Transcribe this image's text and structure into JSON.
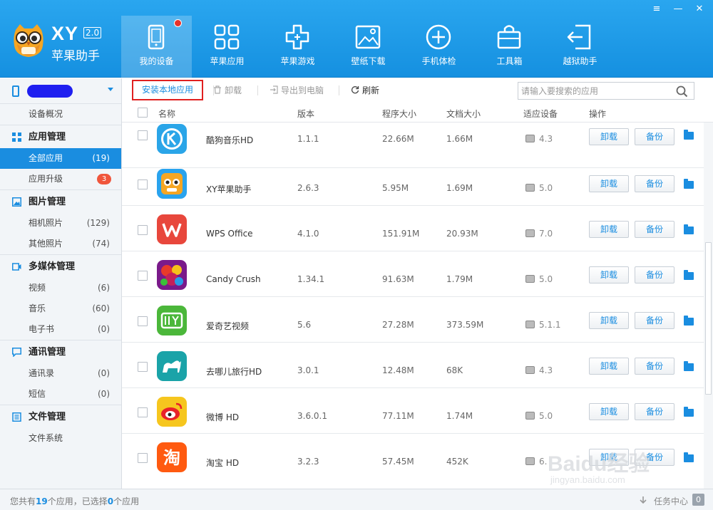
{
  "brand": {
    "logo_text": "XY",
    "version": "2.0",
    "name": "苹果助手"
  },
  "window_controls": {
    "menu": "≡",
    "minimize": "—",
    "close": "✕"
  },
  "nav": [
    {
      "label": "我的设备",
      "icon": "device-icon",
      "active": true,
      "has_dot": true
    },
    {
      "label": "苹果应用",
      "icon": "apps-icon"
    },
    {
      "label": "苹果游戏",
      "icon": "gamepad-icon"
    },
    {
      "label": "壁纸下载",
      "icon": "wallpaper-icon"
    },
    {
      "label": "手机体检",
      "icon": "checkup-icon"
    },
    {
      "label": "工具箱",
      "icon": "toolbox-icon"
    },
    {
      "label": "越狱助手",
      "icon": "jailbreak-icon"
    }
  ],
  "sidebar": {
    "overview": "设备概况",
    "groups": [
      {
        "title": "应用管理",
        "icon": "grid-icon",
        "items": [
          {
            "label": "全部应用",
            "count": "(19)",
            "active": true
          },
          {
            "label": "应用升级",
            "badge": "3"
          }
        ]
      },
      {
        "title": "图片管理",
        "icon": "image-icon",
        "items": [
          {
            "label": "相机照片",
            "count": "(129)"
          },
          {
            "label": "其他照片",
            "count": "(74)"
          }
        ]
      },
      {
        "title": "多媒体管理",
        "icon": "media-icon",
        "items": [
          {
            "label": "视频",
            "count": "(6)"
          },
          {
            "label": "音乐",
            "count": "(60)"
          },
          {
            "label": "电子书",
            "count": "(0)"
          }
        ]
      },
      {
        "title": "通讯管理",
        "icon": "chat-icon",
        "items": [
          {
            "label": "通讯录",
            "count": "(0)"
          },
          {
            "label": "短信",
            "count": "(0)"
          }
        ]
      },
      {
        "title": "文件管理",
        "icon": "file-icon",
        "items": [
          {
            "label": "文件系统"
          }
        ]
      }
    ]
  },
  "toolbar": {
    "install": "安装本地应用",
    "uninstall": "卸载",
    "export": "导出到电脑",
    "refresh": "刷新",
    "search_placeholder": "请输入要搜索的应用"
  },
  "table": {
    "headers": {
      "name": "名称",
      "version": "版本",
      "program_size": "程序大小",
      "doc_size": "文档大小",
      "device": "适应设备",
      "action": "操作"
    },
    "uninstall_label": "卸载",
    "backup_label": "备份",
    "rows": [
      {
        "name": "酷狗音乐HD",
        "version": "1.1.1",
        "program_size": "22.66M",
        "doc_size": "1.66M",
        "device": "4.3",
        "icon": "kugou-icon",
        "color": "#2aa5e8"
      },
      {
        "name": "XY苹果助手",
        "version": "2.6.3",
        "program_size": "5.95M",
        "doc_size": "1.69M",
        "device": "5.0",
        "icon": "xy-owl-icon",
        "color": "#1a8de0"
      },
      {
        "name": "WPS Office",
        "version": "4.1.0",
        "program_size": "151.91M",
        "doc_size": "20.93M",
        "device": "7.0",
        "icon": "wps-icon",
        "color": "#e8473c"
      },
      {
        "name": "Candy Crush",
        "version": "1.34.1",
        "program_size": "91.63M",
        "doc_size": "1.79M",
        "device": "5.0",
        "icon": "candy-crush-icon",
        "color": "#c4205a"
      },
      {
        "name": "爱奇艺视频",
        "version": "5.6",
        "program_size": "27.28M",
        "doc_size": "373.59M",
        "device": "5.1.1",
        "icon": "iqiyi-icon",
        "color": "#4bb73a"
      },
      {
        "name": "去哪儿旅行HD",
        "version": "3.0.1",
        "program_size": "12.48M",
        "doc_size": "68K",
        "device": "4.3",
        "icon": "qunar-icon",
        "color": "#1aa3a8"
      },
      {
        "name": "微博 HD",
        "version": "3.6.0.1",
        "program_size": "77.11M",
        "doc_size": "1.74M",
        "device": "5.0",
        "icon": "weibo-icon",
        "color": "#f4c020"
      },
      {
        "name": "淘宝 HD",
        "version": "3.2.3",
        "program_size": "57.45M",
        "doc_size": "452K",
        "device": "6.",
        "icon": "taobao-icon",
        "color": "#ff5a10"
      }
    ]
  },
  "status": {
    "prefix": "您共有",
    "total": "19",
    "middle": "个应用，已选择",
    "selected": "0",
    "suffix": "个应用",
    "task_center": "任务中心",
    "task_count": "0"
  },
  "watermark": {
    "top": "Baidu经验",
    "bottom": "jingyan.baidu.com"
  }
}
